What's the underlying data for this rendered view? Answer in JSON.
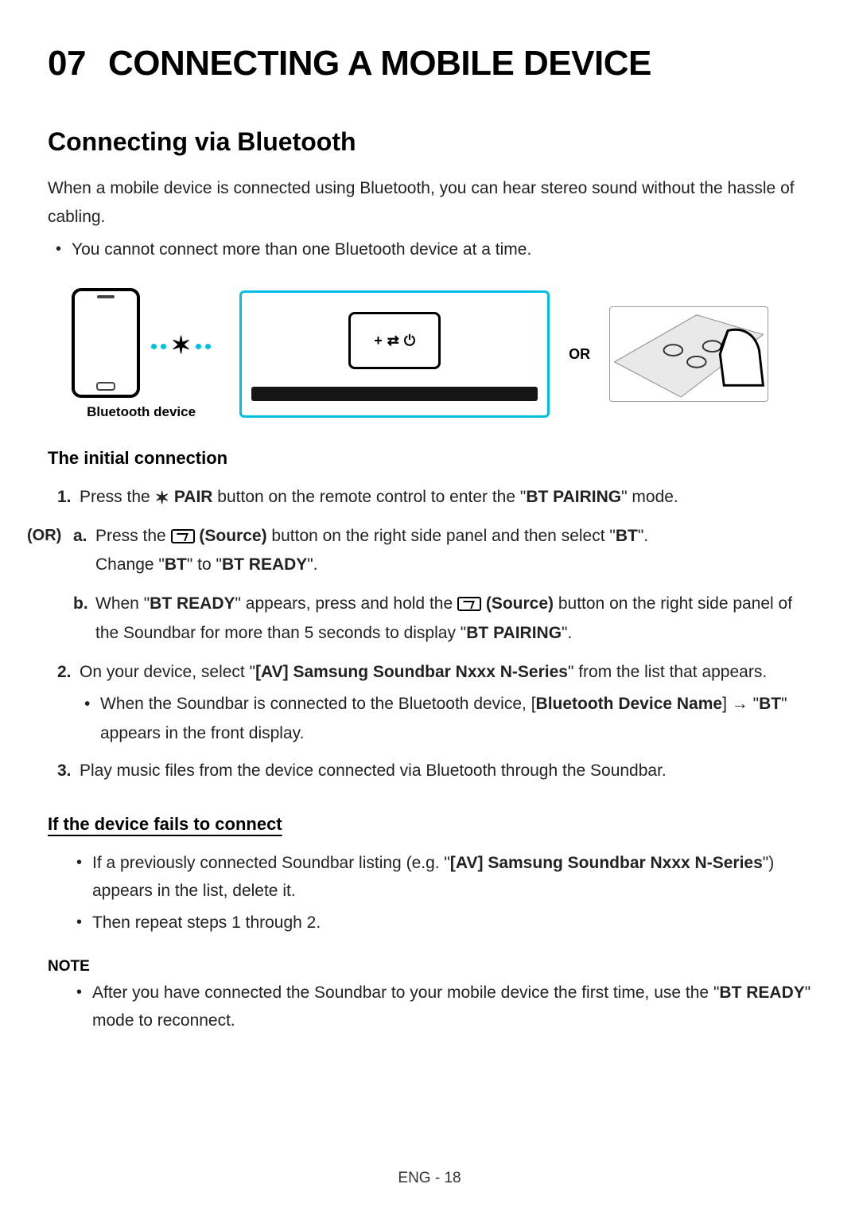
{
  "chapter": {
    "number": "07",
    "title": "CONNECTING A MOBILE DEVICE"
  },
  "section": {
    "title": "Connecting via Bluetooth"
  },
  "intro": "When a mobile device is connected using Bluetooth, you can hear stereo sound without the hassle of cabling.",
  "intro_bullet": "You cannot connect more than one Bluetooth device at a time.",
  "diagram": {
    "bt_device_caption": "Bluetooth device",
    "or_label": "OR"
  },
  "initial": {
    "heading": "The initial connection",
    "step1": {
      "num": "1.",
      "pre": "Press the ",
      "pair": "PAIR",
      "post": " button on the remote control to enter the \"",
      "mode": "BT PAIRING",
      "end": "\" mode."
    },
    "or_marker": "(OR)",
    "step_a": {
      "letter": "a.",
      "pre": "Press the ",
      "source": "(Source)",
      "mid": " button on the right side panel and then select \"",
      "bt1": "BT",
      "mid2": "\".",
      "line2_pre": "Change \"",
      "bt2": "BT",
      "line2_mid": "\" to \"",
      "btready": "BT READY",
      "line2_end": "\"."
    },
    "step_b": {
      "letter": "b.",
      "pre": "When \"",
      "btready": "BT READY",
      "mid": "\" appears, press and hold the ",
      "source": "(Source)",
      "post": " button on the right side panel of the Soundbar for more than 5 seconds to display \"",
      "btpairing": "BT PAIRING",
      "end": "\"."
    },
    "step2": {
      "num": "2.",
      "pre": "On your device, select \"",
      "device": "[AV] Samsung Soundbar Nxxx N-Series",
      "post": "\" from the list that appears.",
      "bullet_pre": "When the Soundbar is connected to the Bluetooth device, [",
      "bdn": "Bluetooth Device Name",
      "bullet_mid": "] → \"",
      "bt": "BT",
      "bullet_end": "\" appears in the front display."
    },
    "step3": {
      "num": "3.",
      "text": "Play music files from the device connected via Bluetooth through the Soundbar."
    }
  },
  "fails": {
    "heading": "If the device fails to connect",
    "b1_pre": "If a previously connected Soundbar listing (e.g. \"",
    "b1_device": "[AV] Samsung Soundbar Nxxx N-Series",
    "b1_post": "\") appears in the list, delete it.",
    "b2": "Then repeat steps 1 through 2."
  },
  "note": {
    "label": "NOTE",
    "pre": "After you have connected the Soundbar to your mobile device the first time, use the \"",
    "btready": "BT READY",
    "post": "\" mode to reconnect."
  },
  "footer": "ENG - 18"
}
